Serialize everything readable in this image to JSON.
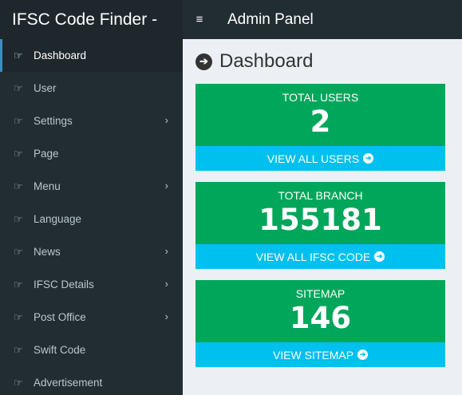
{
  "header": {
    "brand": "IFSC Code Finder -",
    "toggle_icon": "≡",
    "title": "Admin Panel"
  },
  "sidebar": {
    "items": [
      {
        "label": "Dashboard",
        "icon": "hand-pointer-icon",
        "has_submenu": false,
        "active": true
      },
      {
        "label": "User",
        "icon": "hand-pointer-icon",
        "has_submenu": false
      },
      {
        "label": "Settings",
        "icon": "hand-pointer-icon",
        "has_submenu": true
      },
      {
        "label": "Page",
        "icon": "hand-pointer-icon",
        "has_submenu": false
      },
      {
        "label": "Menu",
        "icon": "hand-pointer-icon",
        "has_submenu": true
      },
      {
        "label": "Language",
        "icon": "hand-pointer-icon",
        "has_submenu": false
      },
      {
        "label": "News",
        "icon": "hand-pointer-icon",
        "has_submenu": true
      },
      {
        "label": "IFSC Details",
        "icon": "hand-pointer-icon",
        "has_submenu": true
      },
      {
        "label": "Post Office",
        "icon": "hand-pointer-icon",
        "has_submenu": true
      },
      {
        "label": "Swift Code",
        "icon": "hand-pointer-icon",
        "has_submenu": false
      },
      {
        "label": "Advertisement",
        "icon": "hand-pointer-icon",
        "has_submenu": false
      }
    ]
  },
  "main": {
    "title": "Dashboard",
    "cards": [
      {
        "label": "TOTAL USERS",
        "value": "2",
        "link": "VIEW ALL USERS"
      },
      {
        "label": "TOTAL BRANCH",
        "value": "155181",
        "link": "VIEW ALL IFSC CODE"
      },
      {
        "label": "SITEMAP",
        "value": "146",
        "link": "VIEW SITEMAP"
      }
    ]
  },
  "colors": {
    "card_green": "#00a65a",
    "card_footer_blue": "#00c0ef",
    "sidebar_bg": "#222d32",
    "content_bg": "#ecf0f5"
  }
}
